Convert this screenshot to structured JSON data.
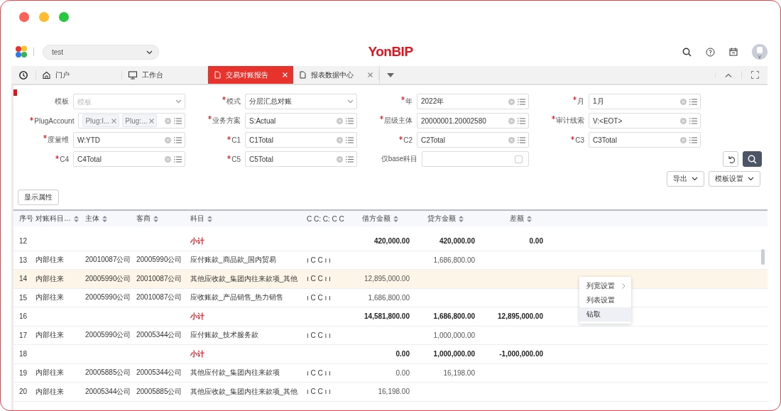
{
  "header": {
    "org_select": {
      "value": "test"
    },
    "brand": "YonBIP",
    "avatar_badge": "Y"
  },
  "tabs": [
    {
      "kind": "home",
      "label": "门户",
      "selected": false,
      "closable": false
    },
    {
      "kind": "desk",
      "label": "工作台",
      "selected": false,
      "closable": false
    },
    {
      "kind": "doc",
      "label": "交易对账报告",
      "selected": true,
      "closable": true
    },
    {
      "kind": "doc",
      "label": "报表数据中心",
      "selected": false,
      "closable": true
    }
  ],
  "filters": [
    {
      "label": "模板",
      "required": false,
      "kind": "select",
      "placeholder": "模板"
    },
    {
      "label": "模式",
      "required": true,
      "kind": "select",
      "value": "分层汇总对账"
    },
    {
      "label": "年",
      "required": true,
      "kind": "lookup",
      "value": "2022年"
    },
    {
      "label": "月",
      "required": true,
      "kind": "lookup",
      "value": "1月"
    },
    {
      "label": "PlugAccount",
      "required": true,
      "kind": "tags",
      "tags": [
        "Plug:I...",
        "Plug:..."
      ]
    },
    {
      "label": "业务方案",
      "required": true,
      "kind": "lookup",
      "value": "S:Actual"
    },
    {
      "label": "层级主体",
      "required": true,
      "kind": "lookup",
      "value": "20000001.20002580"
    },
    {
      "label": "审计线索",
      "required": true,
      "kind": "lookup",
      "value": "V:<EOT>"
    },
    {
      "label": "度量维",
      "required": true,
      "kind": "lookup",
      "value": "W:YTD"
    },
    {
      "label": "C1",
      "required": true,
      "kind": "lookup",
      "value": "C1Total"
    },
    {
      "label": "C2",
      "required": true,
      "kind": "lookup",
      "value": "C2Total"
    },
    {
      "label": "C3",
      "required": true,
      "kind": "lookup",
      "value": "C3Total"
    },
    {
      "label": "C4",
      "required": true,
      "kind": "lookup",
      "value": "C4Total"
    },
    {
      "label": "C5",
      "required": true,
      "kind": "lookup",
      "value": "C5Total"
    },
    {
      "label": "仅base科目",
      "required": false,
      "kind": "checkbox",
      "checked": false
    }
  ],
  "actions": {
    "export": "导出",
    "template_settings": "模板设置",
    "show_attributes": "显示属性"
  },
  "table": {
    "columns": [
      "序号",
      "对账科目…",
      "主体",
      "客商",
      "科目",
      "C C: C: C C",
      "借方金额",
      "贷方金额",
      "差额"
    ],
    "sortable": [
      false,
      true,
      true,
      true,
      true,
      false,
      true,
      true,
      true
    ],
    "rows": [
      {
        "kind": "subtotal",
        "selected": false,
        "cells": [
          "12",
          "",
          "",
          "",
          "小计",
          "",
          "420,000.00",
          "420,000.00",
          "0.00"
        ]
      },
      {
        "kind": "detail",
        "selected": false,
        "cells": [
          "13",
          "内部往来",
          "20010087公司",
          "20005990公司",
          "应付账款_商品款_国内贸易",
          "ı C C ı ı",
          "",
          "1,686,800.00",
          ""
        ]
      },
      {
        "kind": "detail",
        "selected": true,
        "cells": [
          "14",
          "内部往来",
          "20005990公司",
          "20010087公司",
          "其他应收款_集团内往来款项_其他",
          "ı C C ı ı",
          "12,895,000.00",
          "",
          ""
        ]
      },
      {
        "kind": "detail",
        "selected": false,
        "cells": [
          "15",
          "内部往来",
          "20005990公司",
          "20010087公司",
          "应收账款_产品销售_热力销售",
          "ı C C ı ı",
          "1,686,800.00",
          "",
          ""
        ]
      },
      {
        "kind": "subtotal",
        "selected": false,
        "cells": [
          "16",
          "",
          "",
          "",
          "小计",
          "",
          "14,581,800.00",
          "1,686,800.00",
          "12,895,000.00"
        ]
      },
      {
        "kind": "detail",
        "selected": false,
        "cells": [
          "17",
          "内部往来",
          "20005990公司",
          "20005344公司",
          "应付账款_技术服务款",
          "ı C C ı ı",
          "",
          "1,000,000.00",
          ""
        ]
      },
      {
        "kind": "subtotal",
        "selected": false,
        "cells": [
          "18",
          "",
          "",
          "",
          "小计",
          "",
          "0.00",
          "1,000,000.00",
          "-1,000,000.00"
        ]
      },
      {
        "kind": "detail",
        "selected": false,
        "cells": [
          "19",
          "内部往来",
          "20005885公司",
          "20005344公司",
          "其他应付款_集团内往来款项",
          "ı C C ı ı",
          "0.00",
          "16,198.00",
          ""
        ]
      },
      {
        "kind": "detail",
        "selected": false,
        "cells": [
          "20",
          "内部往来",
          "20005344公司",
          "20005885公司",
          "其他应收款_集团内往来款项_其他",
          "ı C C ı ı",
          "16,198.00",
          "",
          ""
        ]
      }
    ]
  },
  "context_menu": [
    {
      "label": "列宽设置",
      "submenu": true,
      "selected": false
    },
    {
      "label": "列表设置",
      "submenu": false,
      "selected": false
    },
    {
      "label": "钻取",
      "submenu": false,
      "selected": true
    }
  ]
}
